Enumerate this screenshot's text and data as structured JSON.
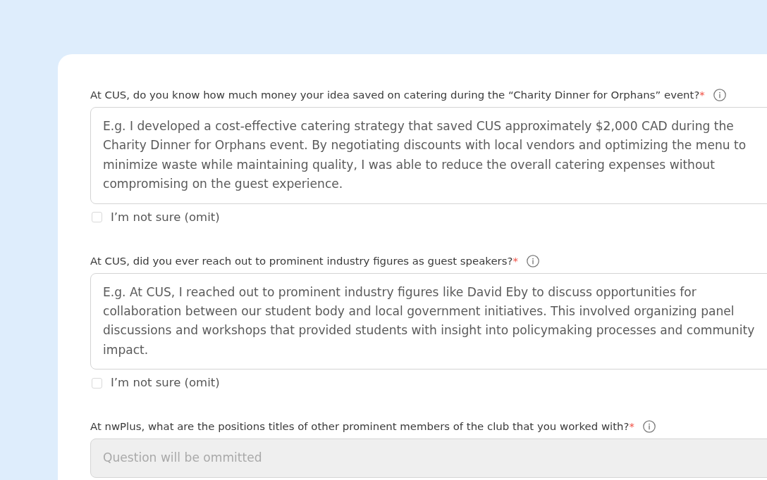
{
  "questions": [
    {
      "label": "At CUS, do you know how much money your idea saved on catering during the “Charity Dinner for Orphans” event?",
      "required_mark": "*",
      "field": {
        "placeholder": "E.g. I developed a cost-effective catering strategy that saved CUS approximately $2,000 CAD during the Charity Dinner for Orphans event. By negotiating discounts with local vendors and optimizing the menu to minimize waste while maintaining quality, I was able to reduce the overall catering expenses without compromising on the guest experience.",
        "disabled": false
      },
      "omit_option": {
        "label": "I’m not sure (omit)",
        "checked": false
      }
    },
    {
      "label": "At CUS, did you ever reach out to prominent industry figures as guest speakers?",
      "required_mark": "*",
      "field": {
        "placeholder": "E.g. At CUS, I reached out to prominent industry figures like David Eby to discuss opportunities for collaboration between our student body and local government initiatives. This involved organizing panel discussions and workshops that provided students with insight into policymaking processes and community impact.",
        "disabled": false
      },
      "omit_option": {
        "label": "I’m not sure (omit)",
        "checked": false
      }
    },
    {
      "label": "At nwPlus, what are the positions titles of other prominent members of the club that you worked with?",
      "required_mark": "*",
      "field": {
        "placeholder": "Question will be ommitted",
        "disabled": true
      }
    }
  ]
}
